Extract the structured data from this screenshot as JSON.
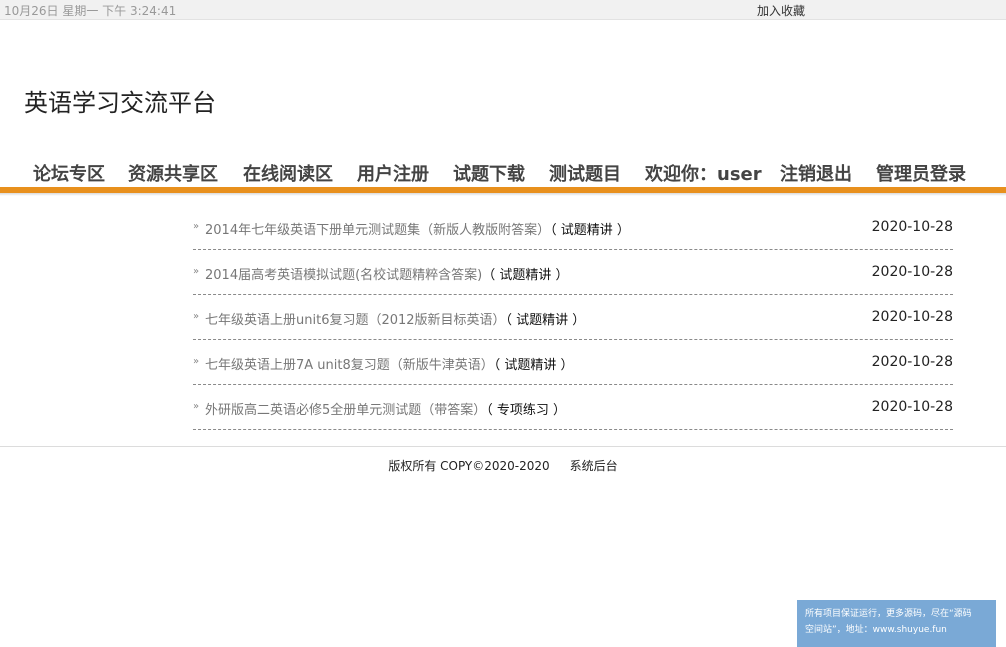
{
  "topbar": {
    "datetime": "10月26日 星期一 下午 3:24:41",
    "bookmark_label": "加入收藏"
  },
  "site_title": "英语学习交流平台",
  "nav": {
    "items": [
      {
        "label": "论坛专区"
      },
      {
        "label": "资源共享区"
      },
      {
        "label": "在线阅读区"
      },
      {
        "label": "用户注册"
      },
      {
        "label": "试题下载"
      },
      {
        "label": "测试题目"
      },
      {
        "label": "欢迎你：user"
      },
      {
        "label": "注销退出"
      },
      {
        "label": "管理员登录"
      }
    ]
  },
  "articles": [
    {
      "arrow": "»",
      "title": "2014年七年级英语下册单元测试题集（新版人教版附答案）",
      "tag": "（ 试题精讲 ）",
      "date": "2020-10-28"
    },
    {
      "arrow": "»",
      "title": "2014届高考英语模拟试题(名校试题精粹含答案)",
      "tag": "（ 试题精讲 ）",
      "date": "2020-10-28"
    },
    {
      "arrow": "»",
      "title": "七年级英语上册unit6复习题（2012版新目标英语）",
      "tag": "（ 试题精讲 ）",
      "date": "2020-10-28"
    },
    {
      "arrow": "»",
      "title": "七年级英语上册7A unit8复习题（新版牛津英语）",
      "tag": "（ 试题精讲 ）",
      "date": "2020-10-28"
    },
    {
      "arrow": "»",
      "title": "外研版高二英语必修5全册单元测试题（带答案）",
      "tag": "（ 专项练习 ）",
      "date": "2020-10-28"
    }
  ],
  "footer": {
    "copyright": "版权所有 COPY©2020-2020",
    "admin_link": "系统后台"
  },
  "notice": {
    "line1": "所有项目保证运行，更多源码，尽在“源码",
    "line2": "空间站”，地址：www.shuyue.fun"
  },
  "colors": {
    "accent": "#e8901d",
    "topbar_bg": "#f1f1f1",
    "notice_bg": "#7aa9d6"
  }
}
